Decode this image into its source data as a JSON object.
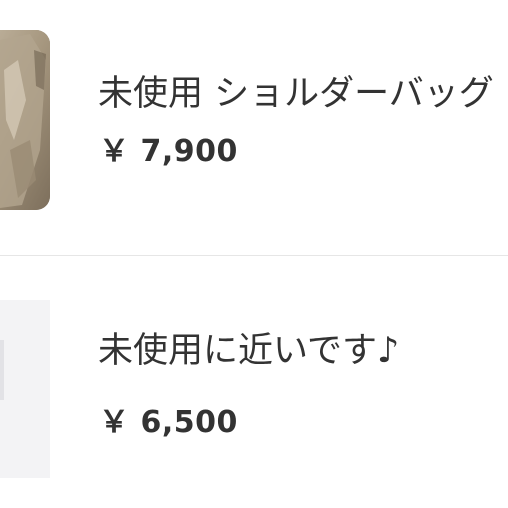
{
  "listings": [
    {
      "title": "未使用 ショルダーバッグ",
      "price": "￥ 7,900",
      "thumbnail_icon": "shoulder-bag-photo"
    },
    {
      "title": "未使用に近いです♪",
      "price": "￥ 6,500",
      "thumbnail_icon": "item-photo"
    }
  ],
  "colors": {
    "text": "#333333",
    "divider": "#e6e6e6",
    "thumb_bg": "#f3f3f5",
    "bag_tone": "#a89880"
  }
}
